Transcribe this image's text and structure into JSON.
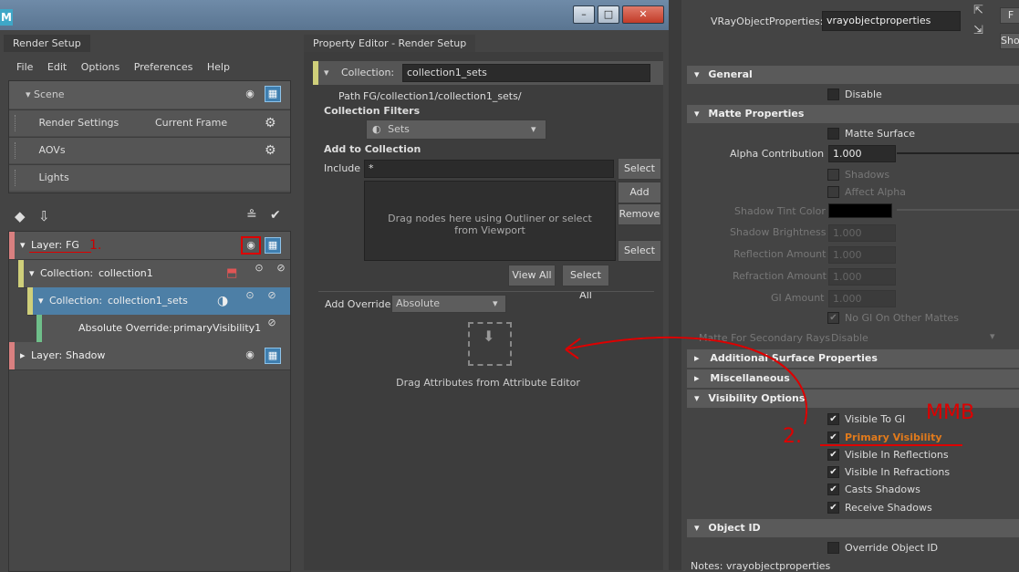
{
  "window": {
    "logo": "M",
    "min": "–",
    "max": "□",
    "close": "✕"
  },
  "render_setup": {
    "tab": "Render Setup",
    "menu": [
      "File",
      "Edit",
      "Options",
      "Preferences",
      "Help"
    ],
    "scene_label": "Scene",
    "rows": [
      {
        "label": "Render Settings",
        "value": "Current Frame"
      },
      {
        "label": "AOVs",
        "value": ""
      },
      {
        "label": "Lights",
        "value": ""
      }
    ],
    "layers": [
      {
        "type": "layer",
        "prefix": "Layer:",
        "name": "FG",
        "annotation": "1."
      },
      {
        "type": "collection",
        "prefix": "Collection:",
        "name": "collection1"
      },
      {
        "type": "collection-sel",
        "prefix": "Collection:",
        "name": "collection1_sets"
      },
      {
        "type": "override",
        "prefix": "Absolute Override:",
        "name": "primaryVisibility1"
      },
      {
        "type": "layer",
        "prefix": "Layer:",
        "name": "Shadow"
      }
    ]
  },
  "property_editor": {
    "tab": "Property Editor - Render Setup",
    "collection_label": "Collection:",
    "collection_value": "collection1_sets",
    "path_label": "Path",
    "path_value": "FG/collection1/collection1_sets/",
    "filters_label": "Collection Filters",
    "filters_value": "Sets",
    "add_label": "Add to Collection",
    "include_label": "Include",
    "include_value": "*",
    "select_btn": "Select",
    "add_btn": "Add",
    "remove_btn": "Remove",
    "select2_btn": "Select",
    "drop_hint": "Drag nodes here using Outliner or select from Viewport",
    "view_all": "View All",
    "select_all": "Select All",
    "override_label": "Add Override",
    "override_value": "Absolute",
    "drag_attr": "Drag Attributes from Attribute Editor"
  },
  "attribute_editor": {
    "vop_label": "VRayObjectProperties:",
    "vop_value": "vrayobjectproperties",
    "show_btn": "Show",
    "sections": {
      "general": "General",
      "matte": "Matte Properties",
      "additional": "Additional Surface Properties",
      "misc": "Miscellaneous",
      "visibility": "Visibility Options",
      "objectid": "Object ID"
    },
    "disable": "Disable",
    "matte_surface": "Matte Surface",
    "alpha_label": "Alpha Contribution",
    "alpha_value": "1.000",
    "shadows": "Shadows",
    "affect_alpha": "Affect Alpha",
    "shadow_tint": "Shadow Tint Color",
    "shadow_brightness": "Shadow Brightness",
    "shadow_brightness_value": "1.000",
    "reflection_amount": "Reflection Amount",
    "reflection_value": "1.000",
    "refraction_amount": "Refraction Amount",
    "refraction_value": "1.000",
    "gi_amount": "GI Amount",
    "gi_value": "1.000",
    "no_gi": "No GI On Other Mattes",
    "matte_secondary": "Matte For Secondary Rays",
    "matte_secondary_value": "Disable",
    "visibility": [
      {
        "label": "Visible To GI",
        "checked": true
      },
      {
        "label": "Primary Visibility",
        "checked": true
      },
      {
        "label": "Visible In Reflections",
        "checked": true
      },
      {
        "label": "Visible In Refractions",
        "checked": true
      },
      {
        "label": "Casts Shadows",
        "checked": true
      },
      {
        "label": "Receive Shadows",
        "checked": true
      }
    ],
    "override_id": "Override Object ID",
    "notes": "Notes:  vrayobjectproperties"
  },
  "annotations": {
    "mmb": "MMB",
    "two": "2."
  },
  "colors": {
    "accent": "#3f7fb0",
    "highlight_orange": "#e07a1c",
    "annotation_red": "#d00000"
  }
}
